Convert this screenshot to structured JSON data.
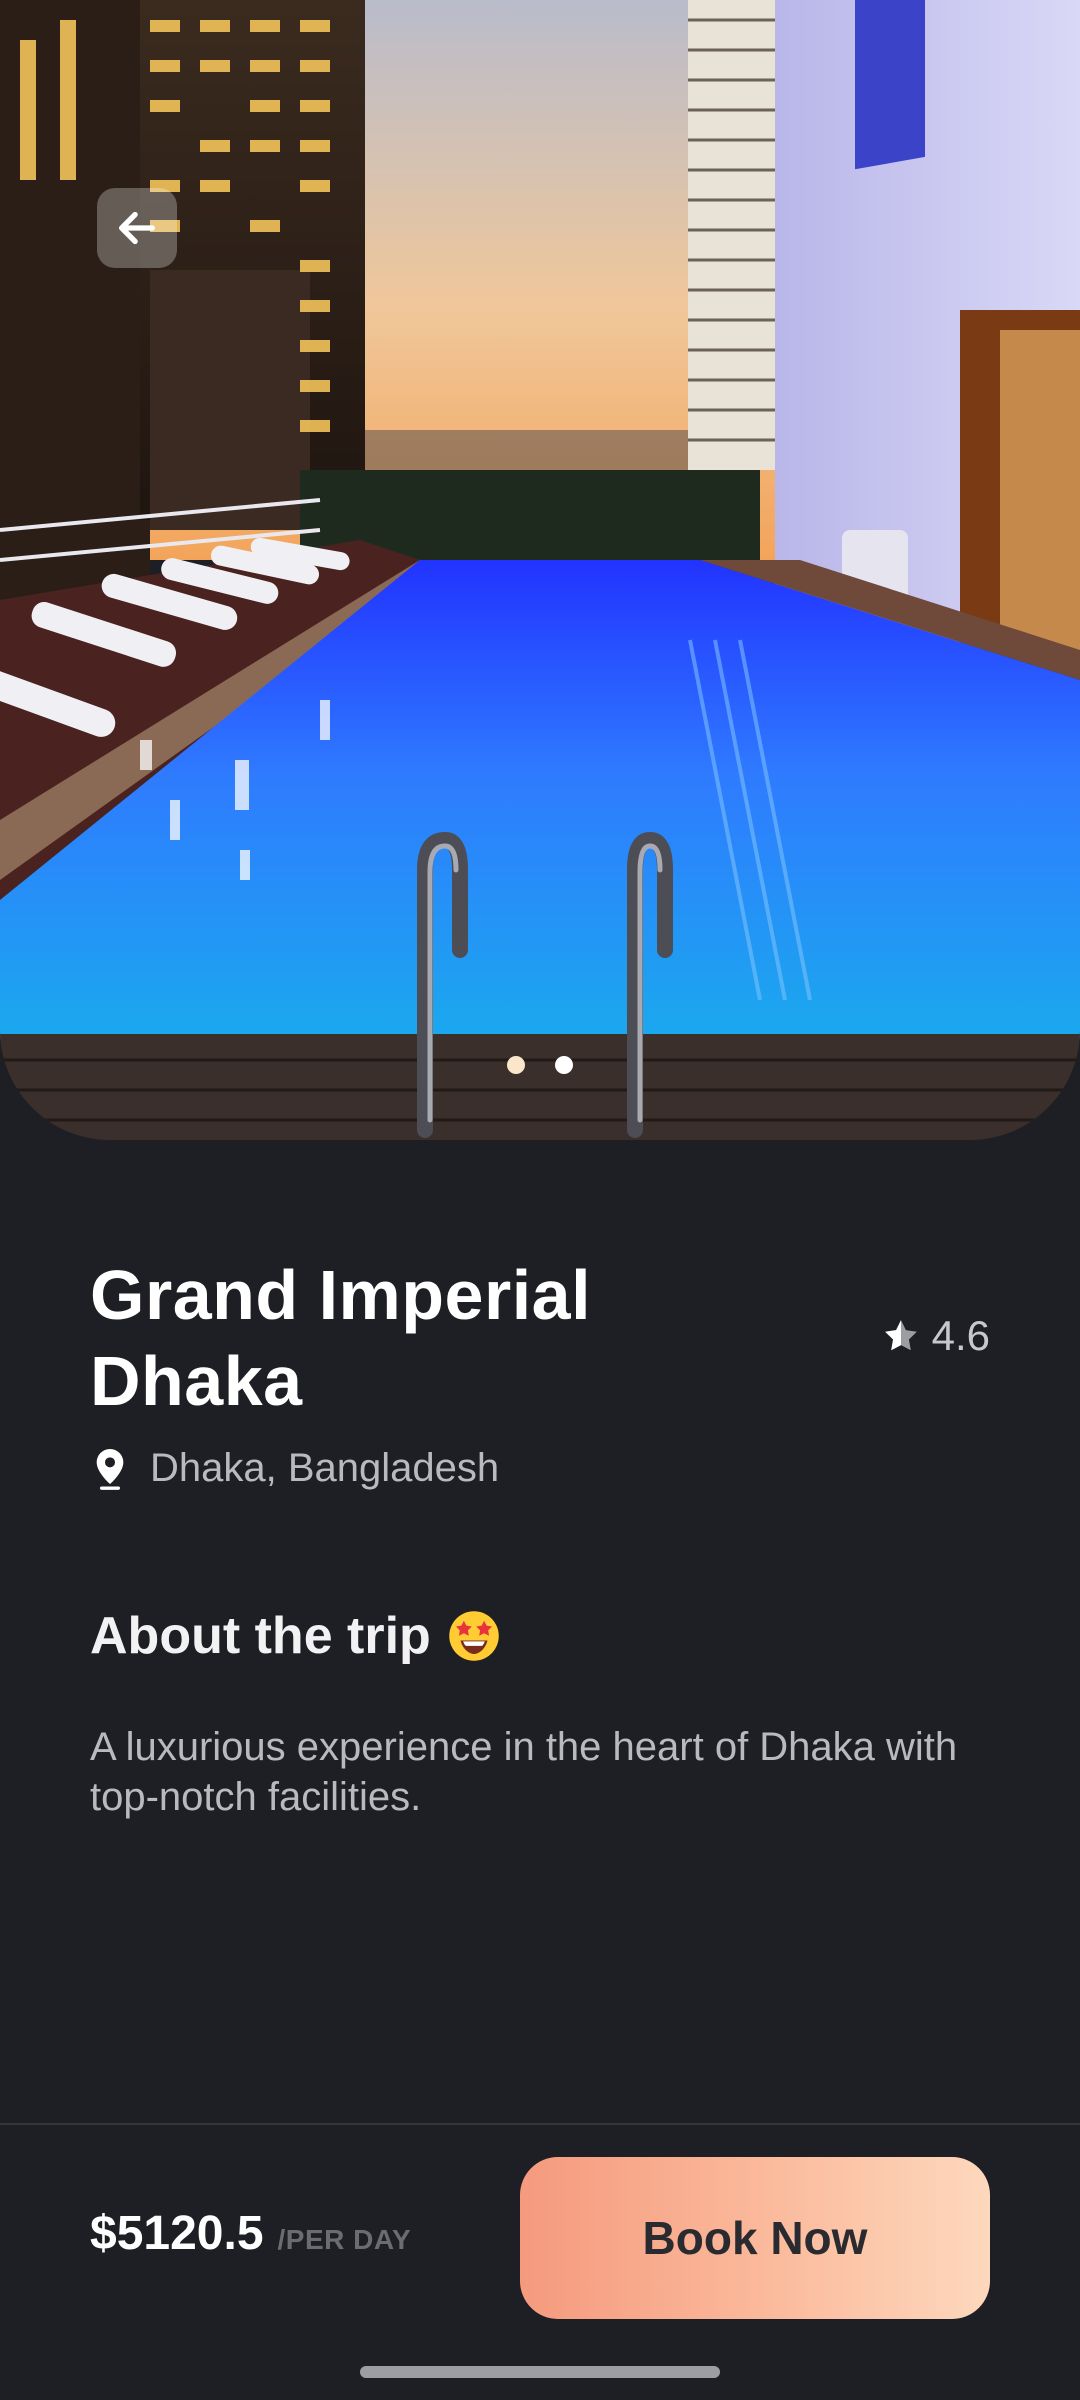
{
  "hotel": {
    "name": "Grand Imperial Dhaka",
    "rating": "4.6",
    "location": "Dhaka, Bangladesh"
  },
  "about": {
    "title": "About the trip",
    "emoji": "🤩",
    "description": "A luxurious experience in the heart of Dhaka with top-notch facilities."
  },
  "booking": {
    "price": "$5120.5",
    "unit": "/PER DAY",
    "button_label": "Book Now"
  },
  "carousel": {
    "page_count": 2,
    "active_index": 0
  },
  "colors": {
    "background": "#1e1f24",
    "button_gradient_start": "#f59a7e",
    "button_gradient_end": "#fdd8bd",
    "text_primary": "#ffffff",
    "text_secondary": "#b9bac0"
  },
  "icons": {
    "back": "arrow-left-icon",
    "rating": "star-half-icon",
    "location": "map-pin-icon"
  }
}
